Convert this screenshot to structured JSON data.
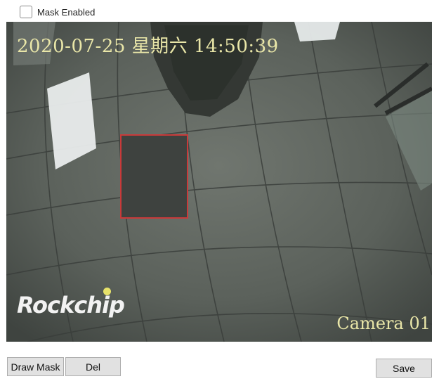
{
  "mask_toggle": {
    "label": "Mask Enabled",
    "checked": false
  },
  "video": {
    "osd_datetime": "2020-07-25 星期六 14:50:39",
    "osd_camera": "Camera 01",
    "logo": "Rockchip"
  },
  "buttons": {
    "draw_mask": "Draw Mask",
    "delete": "Del",
    "save": "Save"
  },
  "colors": {
    "osd_text": "#e9e6a8",
    "mask_border": "#c83a3a",
    "mask_fill": "#3e423f"
  }
}
